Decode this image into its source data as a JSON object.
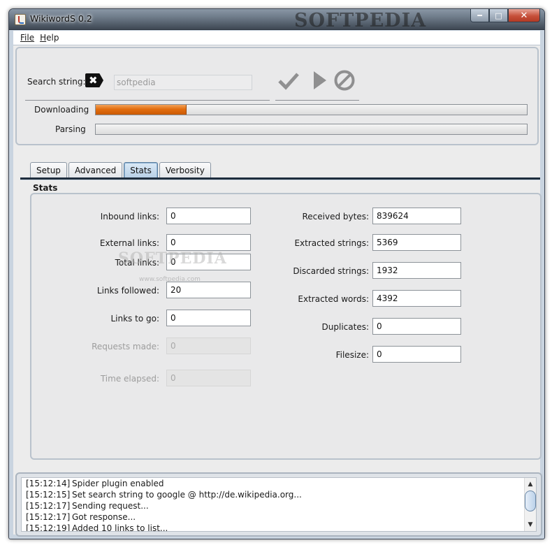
{
  "window": {
    "title": "WikiwordS 0.2",
    "watermark": "SOFTPEDIA"
  },
  "menu": {
    "file": "File",
    "help": "Help"
  },
  "search": {
    "label": "Search string:",
    "value": "softpedia"
  },
  "progress": {
    "downloading": {
      "label": "Downloading",
      "fraction": 0.21
    },
    "parsing": {
      "label": "Parsing",
      "fraction": 0.0
    }
  },
  "tabs": [
    "Setup",
    "Advanced",
    "Stats",
    "Verbosity"
  ],
  "active_tab": "Stats",
  "stats": {
    "title": "Stats",
    "left": [
      {
        "label": "Inbound links:",
        "value": "0",
        "enabled": true
      },
      {
        "label": "External links:",
        "value": "0",
        "enabled": true
      },
      {
        "label": "Total links:",
        "value": "0",
        "enabled": true
      },
      {
        "label": "Links followed:",
        "value": "20",
        "enabled": true
      },
      {
        "label": "Links to go:",
        "value": "0",
        "enabled": true
      },
      {
        "label": "Requests made:",
        "value": "0",
        "enabled": false
      },
      {
        "label": "Time elapsed:",
        "value": "0",
        "enabled": false
      }
    ],
    "right": [
      {
        "label": "Received bytes:",
        "value": "839624"
      },
      {
        "label": "Extracted strings:",
        "value": "5369"
      },
      {
        "label": "Discarded strings:",
        "value": "1932"
      },
      {
        "label": "Extracted words:",
        "value": "4392"
      },
      {
        "label": "Duplicates:",
        "value": "0"
      },
      {
        "label": "Filesize:",
        "value": "0"
      }
    ]
  },
  "overlay_watermark": {
    "text": "SOFTPEDIA",
    "url": "www.softpedia.com"
  },
  "log": [
    {
      "time": "[15:12:14]",
      "text": "Spider plugin enabled"
    },
    {
      "time": "[15:12:15]",
      "text": "Set search string to google @ http://de.wikipedia.org..."
    },
    {
      "time": "[15:12:17]",
      "text": "Sending request..."
    },
    {
      "time": "[15:12:17]",
      "text": "Got response..."
    },
    {
      "time": "[15:12:19]",
      "text": "Added 10 links to list..."
    }
  ],
  "icons": {
    "clear": "clear-icon",
    "accept": "checkmark-icon",
    "start": "play-icon",
    "stop": "stop-icon"
  },
  "colors": {
    "progress": "#e36d0f",
    "active_tab": "#b6cfe6"
  }
}
